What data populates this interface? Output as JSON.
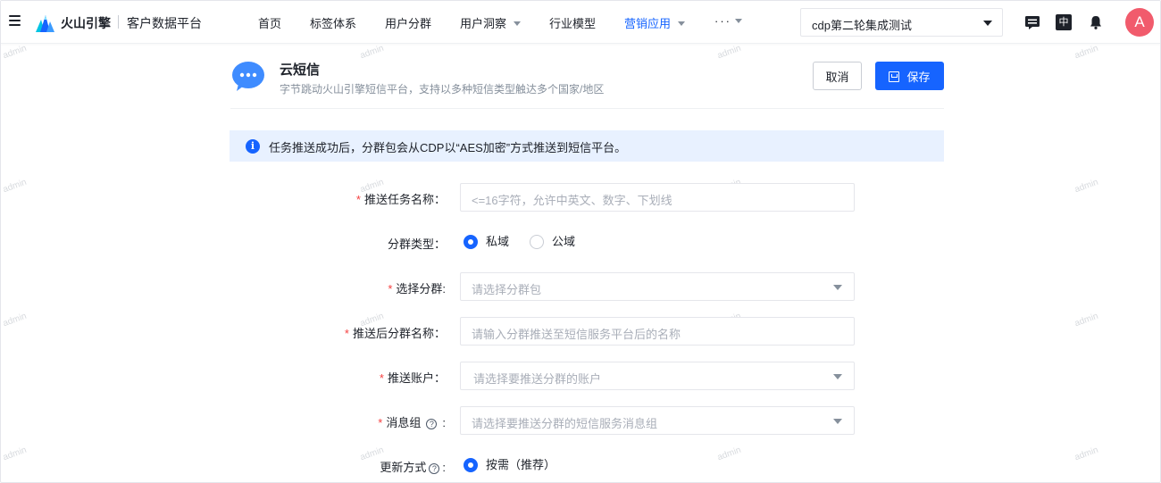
{
  "header": {
    "brand": "火山引擎",
    "product": "客户数据平台",
    "nav": [
      {
        "label": "首页",
        "active": false,
        "dropdown": false
      },
      {
        "label": "标签体系",
        "active": false,
        "dropdown": false
      },
      {
        "label": "用户分群",
        "active": false,
        "dropdown": false
      },
      {
        "label": "用户洞察",
        "active": false,
        "dropdown": true
      },
      {
        "label": "行业模型",
        "active": false,
        "dropdown": false
      },
      {
        "label": "营销应用",
        "active": true,
        "dropdown": true
      },
      {
        "label": "···",
        "active": false,
        "dropdown": true
      }
    ],
    "project_select": "cdp第二轮集成测试",
    "icons": [
      "message-icon",
      "language-icon",
      "bell-icon"
    ],
    "language_label": "中",
    "avatar_letter": "A"
  },
  "watermark": "admin",
  "page": {
    "title": "云短信",
    "subtitle": "字节跳动火山引擎短信平台，支持以多种短信类型触达多个国家/地区",
    "cancel_label": "取消",
    "save_label": "保存"
  },
  "banner": {
    "icon_char": "i",
    "text": "任务推送成功后，分群包会从CDP以“AES加密”方式推送到短信平台。"
  },
  "form": {
    "task_name": {
      "label": "推送任务名称：",
      "required": true,
      "placeholder": "<=16字符，允许中英文、数字、下划线"
    },
    "segment_type": {
      "label": "分群类型：",
      "required": false,
      "options": [
        "私域",
        "公域"
      ],
      "selected": "私域"
    },
    "segment": {
      "label": "选择分群:",
      "required": true,
      "placeholder": "请选择分群包"
    },
    "pushed_name": {
      "label": "推送后分群名称：",
      "required": true,
      "placeholder": "请输入分群推送至短信服务平台后的名称"
    },
    "account": {
      "label": "推送账户：",
      "required": true,
      "placeholder": "请选择要推送分群的账户"
    },
    "message_group": {
      "label": "消息组",
      "required": true,
      "help": "?",
      "suffix": ":",
      "placeholder": "请选择要推送分群的短信服务消息组"
    },
    "update_mode": {
      "label": "更新方式",
      "required": false,
      "help": "?",
      "suffix": ":",
      "options": [
        "按需（推荐）"
      ],
      "selected": "按需（推荐）"
    }
  },
  "colors": {
    "accent": "#1664ff",
    "required": "#f53f3f",
    "avatar": "#f15b6c",
    "banner_bg": "#e8f1ff"
  }
}
